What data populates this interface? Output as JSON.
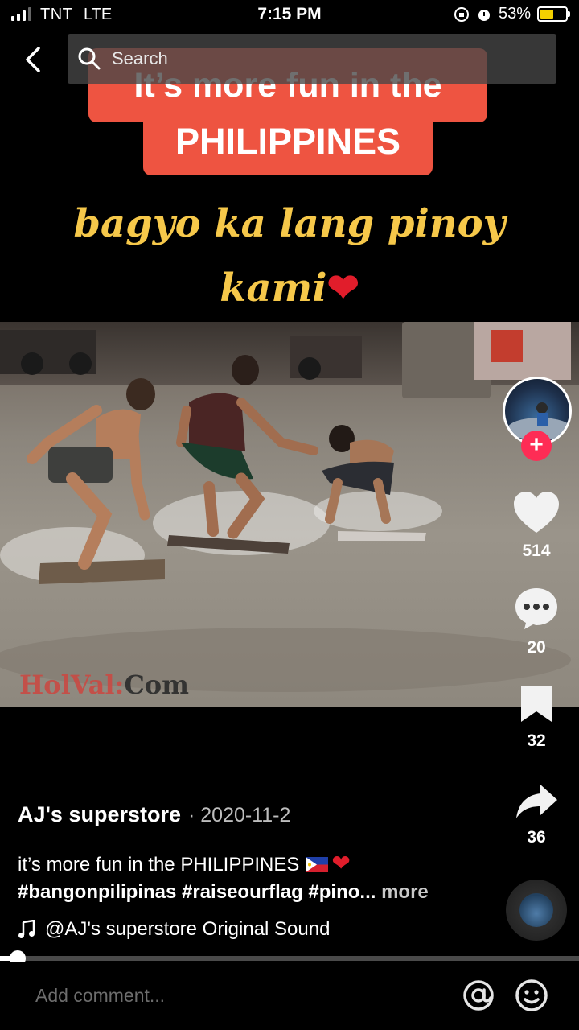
{
  "status_bar": {
    "carrier": "TNT",
    "network": "LTE",
    "time": "7:15 PM",
    "battery": "53%",
    "battery_level": 0.53
  },
  "search": {
    "placeholder": "Search"
  },
  "overlay": {
    "banner_line1": "It’s more fun in the",
    "banner_line2": "PHILIPPINES",
    "script_line1": "bagyo ka lang pinoy",
    "script_line2": "kami",
    "heart_emoji": "❤"
  },
  "photo": {
    "watermark_red": "HolVal:",
    "watermark_dark": "Com"
  },
  "actions": {
    "likes": "514",
    "comments": "20",
    "saves": "32",
    "shares": "36"
  },
  "post": {
    "username": "AJ's superstore",
    "date": "· 2020-11-2",
    "description": "it’s more fun in the PHILIPPINES",
    "hashtags": "#bangonpilipinas #raiseourflag #pino...",
    "more_label": "more",
    "sound": "@AJ's superstore Original Sound"
  },
  "playback": {
    "progress": 0.03
  },
  "comment_bar": {
    "placeholder": "Add comment..."
  },
  "colors": {
    "accent": "#fe2c55",
    "banner": "#ee5441",
    "script_text": "#f6c84a"
  }
}
